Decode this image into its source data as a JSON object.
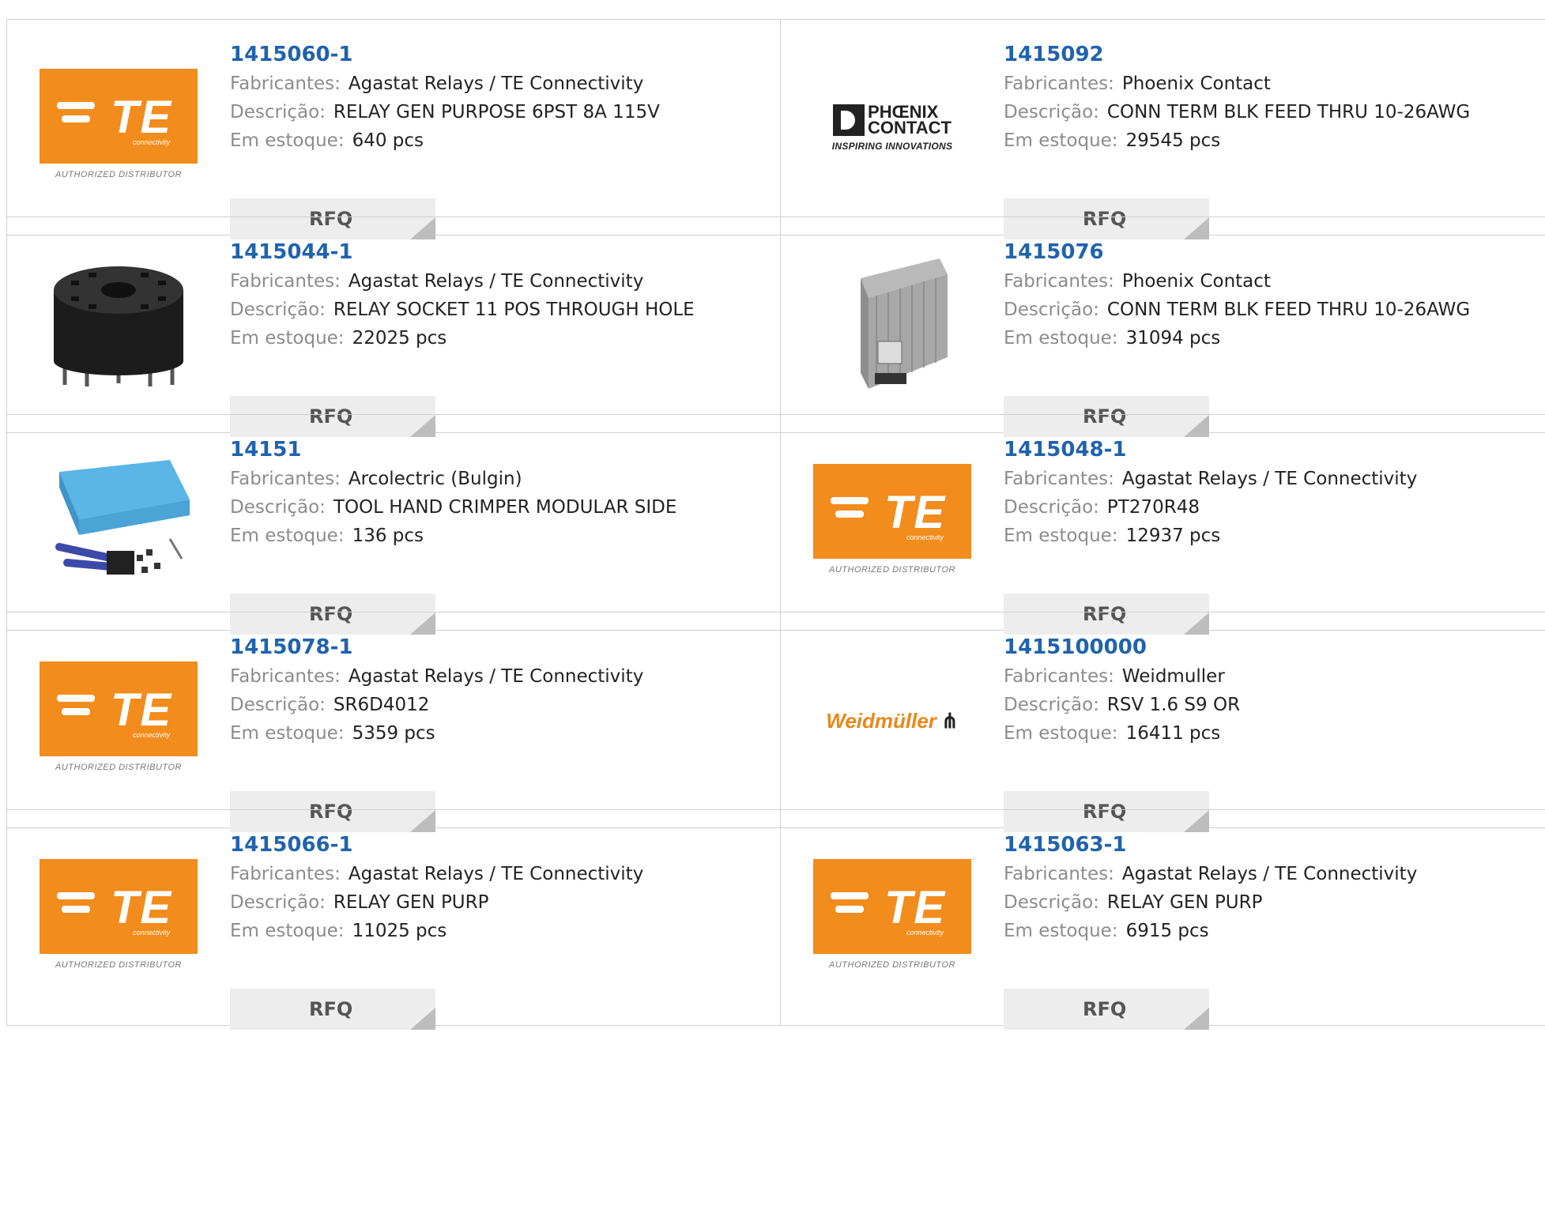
{
  "labels": {
    "manufacturer": "Fabricantes:",
    "description": "Descrição:",
    "stock": "Em estoque:",
    "rfq": "RFQ"
  },
  "logos": {
    "te": {
      "name": "TE",
      "sub": "connectivity",
      "authorized": "AUTHORIZED DISTRIBUTOR"
    },
    "phoenix": {
      "line1": "PHŒNIX",
      "line2": "CONTACT",
      "tagline": "INSPIRING INNOVATIONS"
    },
    "weidmuller": {
      "name": "Weidmüller"
    }
  },
  "products": [
    {
      "part": "1415060-1",
      "manufacturer": "Agastat Relays / TE Connectivity",
      "description": "RELAY GEN PURPOSE 6PST 8A 115V",
      "stock": "640 pcs",
      "image": "te-logo"
    },
    {
      "part": "1415092",
      "manufacturer": "Phoenix Contact",
      "description": "CONN TERM BLK FEED THRU 10-26AWG",
      "stock": "29545 pcs",
      "image": "phoenix-logo"
    },
    {
      "part": "1415044-1",
      "manufacturer": "Agastat Relays / TE Connectivity",
      "description": "RELAY SOCKET 11 POS THROUGH HOLE",
      "stock": "22025 pcs",
      "image": "relay-socket-photo"
    },
    {
      "part": "1415076",
      "manufacturer": "Phoenix Contact",
      "description": "CONN TERM BLK FEED THRU 10-26AWG",
      "stock": "31094 pcs",
      "image": "terminal-block-photo"
    },
    {
      "part": "14151",
      "manufacturer": "Arcolectric (Bulgin)",
      "description": "TOOL HAND CRIMPER MODULAR SIDE",
      "stock": "136 pcs",
      "image": "crimper-kit-photo"
    },
    {
      "part": "1415048-1",
      "manufacturer": "Agastat Relays / TE Connectivity",
      "description": "PT270R48",
      "stock": "12937 pcs",
      "image": "te-logo"
    },
    {
      "part": "1415078-1",
      "manufacturer": "Agastat Relays / TE Connectivity",
      "description": "SR6D4012",
      "stock": "5359 pcs",
      "image": "te-logo"
    },
    {
      "part": "1415100000",
      "manufacturer": "Weidmuller",
      "description": "RSV 1.6 S9 OR",
      "stock": "16411 pcs",
      "image": "weidmuller-logo"
    },
    {
      "part": "1415066-1",
      "manufacturer": "Agastat Relays / TE Connectivity",
      "description": "RELAY GEN PURP",
      "stock": "11025 pcs",
      "image": "te-logo"
    },
    {
      "part": "1415063-1",
      "manufacturer": "Agastat Relays / TE Connectivity",
      "description": "RELAY GEN PURP",
      "stock": "6915 pcs",
      "image": "te-logo"
    }
  ],
  "colors": {
    "part_link": "#1f63ad",
    "label": "#8c8c8c",
    "value": "#222222",
    "rfq_bg": "#ededed",
    "te_orange": "#f28c1c",
    "weidmuller_orange": "#e8891a"
  }
}
